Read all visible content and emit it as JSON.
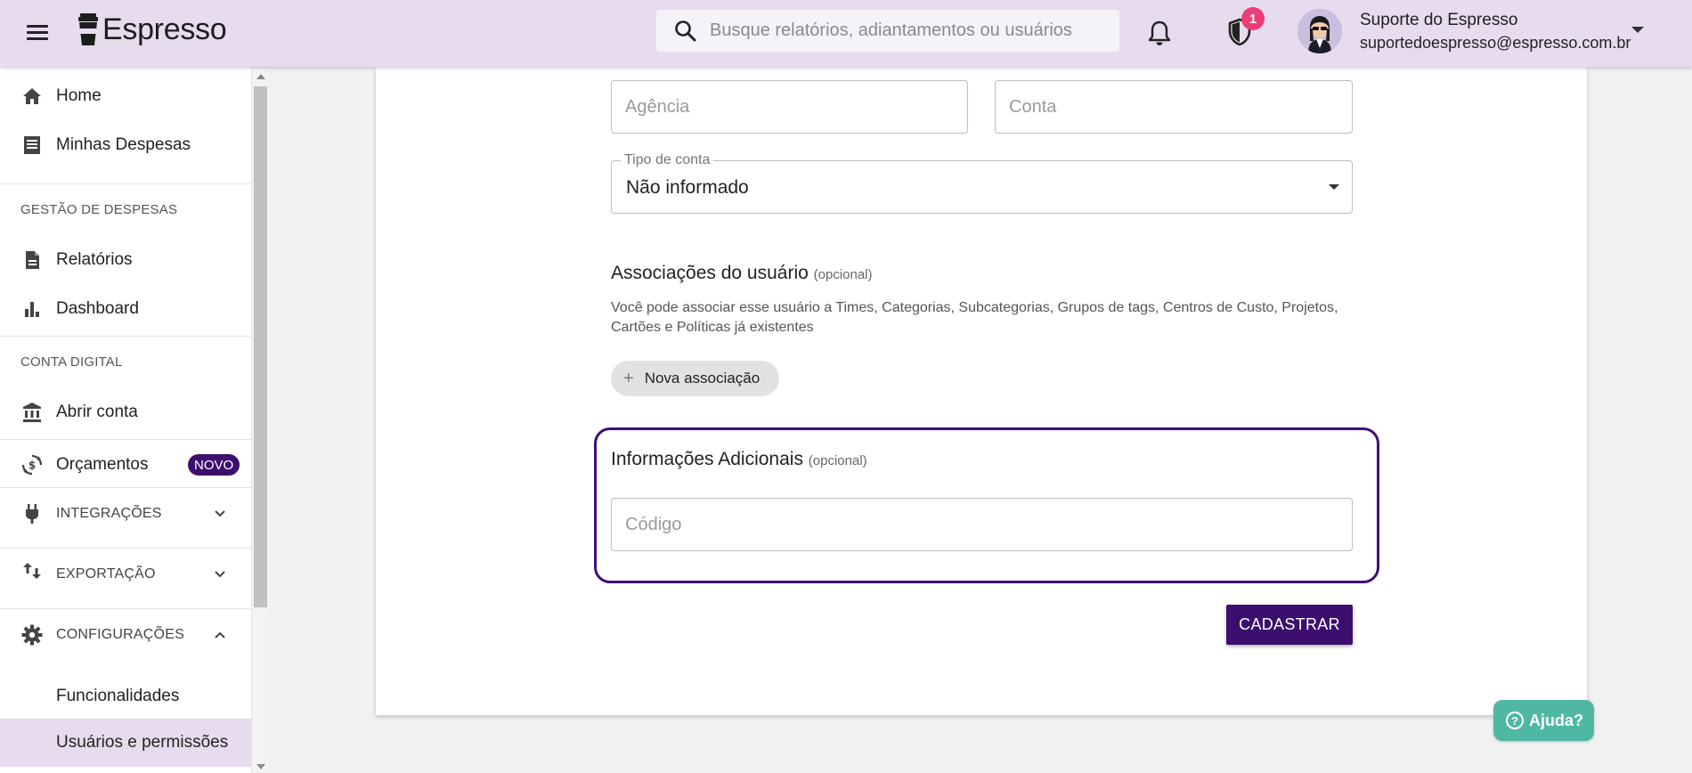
{
  "app": {
    "name": "Espresso"
  },
  "search": {
    "placeholder": "Busque relatórios, adiantamentos ou usuários"
  },
  "notifications": {
    "shield_count": "1"
  },
  "user": {
    "name": "Suporte do Espresso",
    "email": "suportedoespresso@espresso.com.br"
  },
  "sidebar": {
    "home": "Home",
    "minhas_despesas": "Minhas Despesas",
    "section_gestao": "GESTÃO DE DESPESAS",
    "relatorios": "Relatórios",
    "dashboard": "Dashboard",
    "section_conta": "CONTA DIGITAL",
    "abrir_conta": "Abrir conta",
    "orcamentos": "Orçamentos",
    "novo_badge": "NOVO",
    "integracoes": "INTEGRAÇÕES",
    "exportacao": "EXPORTAÇÃO",
    "configuracoes": "CONFIGURAÇÕES",
    "funcionalidades": "Funcionalidades",
    "usuarios_permissoes": "Usuários e permissões"
  },
  "form": {
    "agencia_placeholder": "Agência",
    "conta_placeholder": "Conta",
    "tipo_conta_label": "Tipo de conta",
    "tipo_conta_value": "Não informado",
    "assoc_title": "Associações do usuário",
    "assoc_optional": "(opcional)",
    "assoc_desc": "Você pode associar esse usuário a Times, Categorias, Subcategorias, Grupos de tags, Centros de Custo, Projetos, Cartões e Políticas já existentes",
    "nova_associacao": "Nova associação",
    "info_title": "Informações Adicionais",
    "info_optional": "(opcional)",
    "codigo_placeholder": "Código",
    "submit": "CADASTRAR"
  },
  "help": {
    "label": "Ajuda?"
  },
  "colors": {
    "primary": "#3c0f6e",
    "topbar": "#e6dcee",
    "badge": "#ee3d76",
    "help": "#4fb8a3"
  }
}
